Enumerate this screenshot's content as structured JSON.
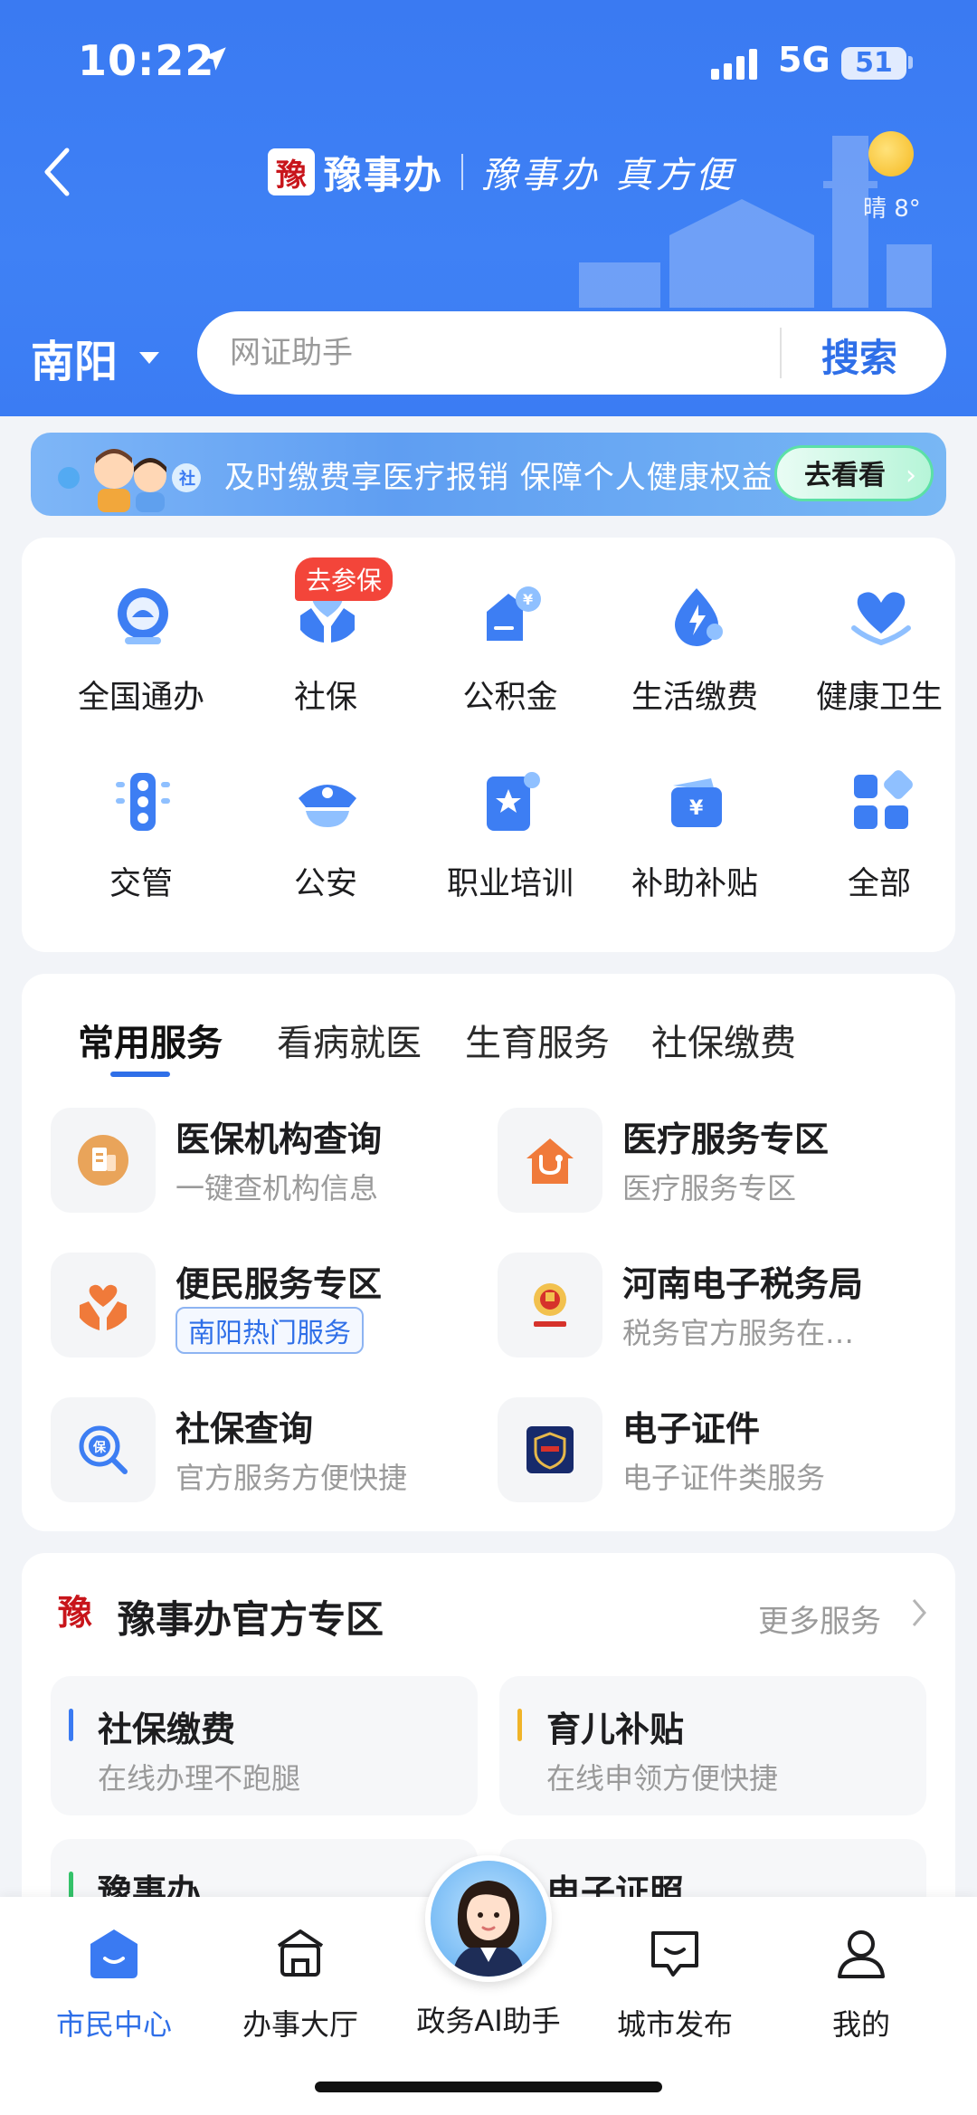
{
  "status_bar": {
    "time": "10:22",
    "network": "5G",
    "battery": "51"
  },
  "header": {
    "brand_seal": "豫",
    "brand_name": "豫事办",
    "slogan": "豫事办 真方便",
    "weather": "晴 8°",
    "city": "南阳",
    "search_placeholder": "网证助手",
    "search_button": "搜索"
  },
  "banner": {
    "text": "及时缴费享医疗报销 保障个人健康权益",
    "button": "去看看"
  },
  "quick_grid": {
    "badge": "去参保",
    "items": [
      {
        "label": "全国通办",
        "icon": "national-service-icon"
      },
      {
        "label": "社保",
        "icon": "social-security-icon"
      },
      {
        "label": "公积金",
        "icon": "housing-fund-icon"
      },
      {
        "label": "生活缴费",
        "icon": "utility-payment-icon"
      },
      {
        "label": "健康卫生",
        "icon": "health-icon"
      },
      {
        "label": "交管",
        "icon": "traffic-icon"
      },
      {
        "label": "公安",
        "icon": "police-icon"
      },
      {
        "label": "职业培训",
        "icon": "training-icon"
      },
      {
        "label": "补助补贴",
        "icon": "subsidy-icon"
      },
      {
        "label": "全部",
        "icon": "all-apps-icon"
      }
    ]
  },
  "services": {
    "tabs": [
      "常用服务",
      "看病就医",
      "生育服务",
      "社保缴费"
    ],
    "active_tab": 0,
    "items": [
      {
        "title": "医保机构查询",
        "subtitle": "一键查机构信息",
        "icon": "medical-institution-icon"
      },
      {
        "title": "医疗服务专区",
        "subtitle": "医疗服务专区",
        "icon": "medical-service-icon"
      },
      {
        "title": "便民服务专区",
        "tag": "南阳热门服务",
        "icon": "convenience-icon"
      },
      {
        "title": "河南电子税务局",
        "subtitle": "税务官方服务在…",
        "icon": "tax-bureau-icon"
      },
      {
        "title": "社保查询",
        "subtitle": "官方服务方便快捷",
        "icon": "social-security-search-icon"
      },
      {
        "title": "电子证件",
        "subtitle": "电子证件类服务",
        "icon": "e-certificate-icon"
      }
    ]
  },
  "official_zone": {
    "seal": "豫",
    "title": "豫事办官方专区",
    "more": "更多服务",
    "items": [
      {
        "title": "社保缴费",
        "subtitle": "在线办理不跑腿",
        "color": "#3a7af2"
      },
      {
        "title": "育儿补贴",
        "subtitle": "在线申领方便快捷",
        "color": "#f0b429"
      },
      {
        "title": "豫事办",
        "subtitle": "",
        "color": "#34c26a"
      },
      {
        "title": "电子证照",
        "subtitle": "",
        "color": "#3a7af2"
      }
    ]
  },
  "bottom_nav": {
    "items": [
      {
        "label": "市民中心",
        "active": true
      },
      {
        "label": "办事大厅",
        "active": false
      },
      {
        "label": "政务AI助手",
        "active": false
      },
      {
        "label": "城市发布",
        "active": false
      },
      {
        "label": "我的",
        "active": false
      }
    ]
  },
  "colors": {
    "primary": "#3a7af2",
    "badge": "#f3453a",
    "orange": "#f07a3a"
  }
}
